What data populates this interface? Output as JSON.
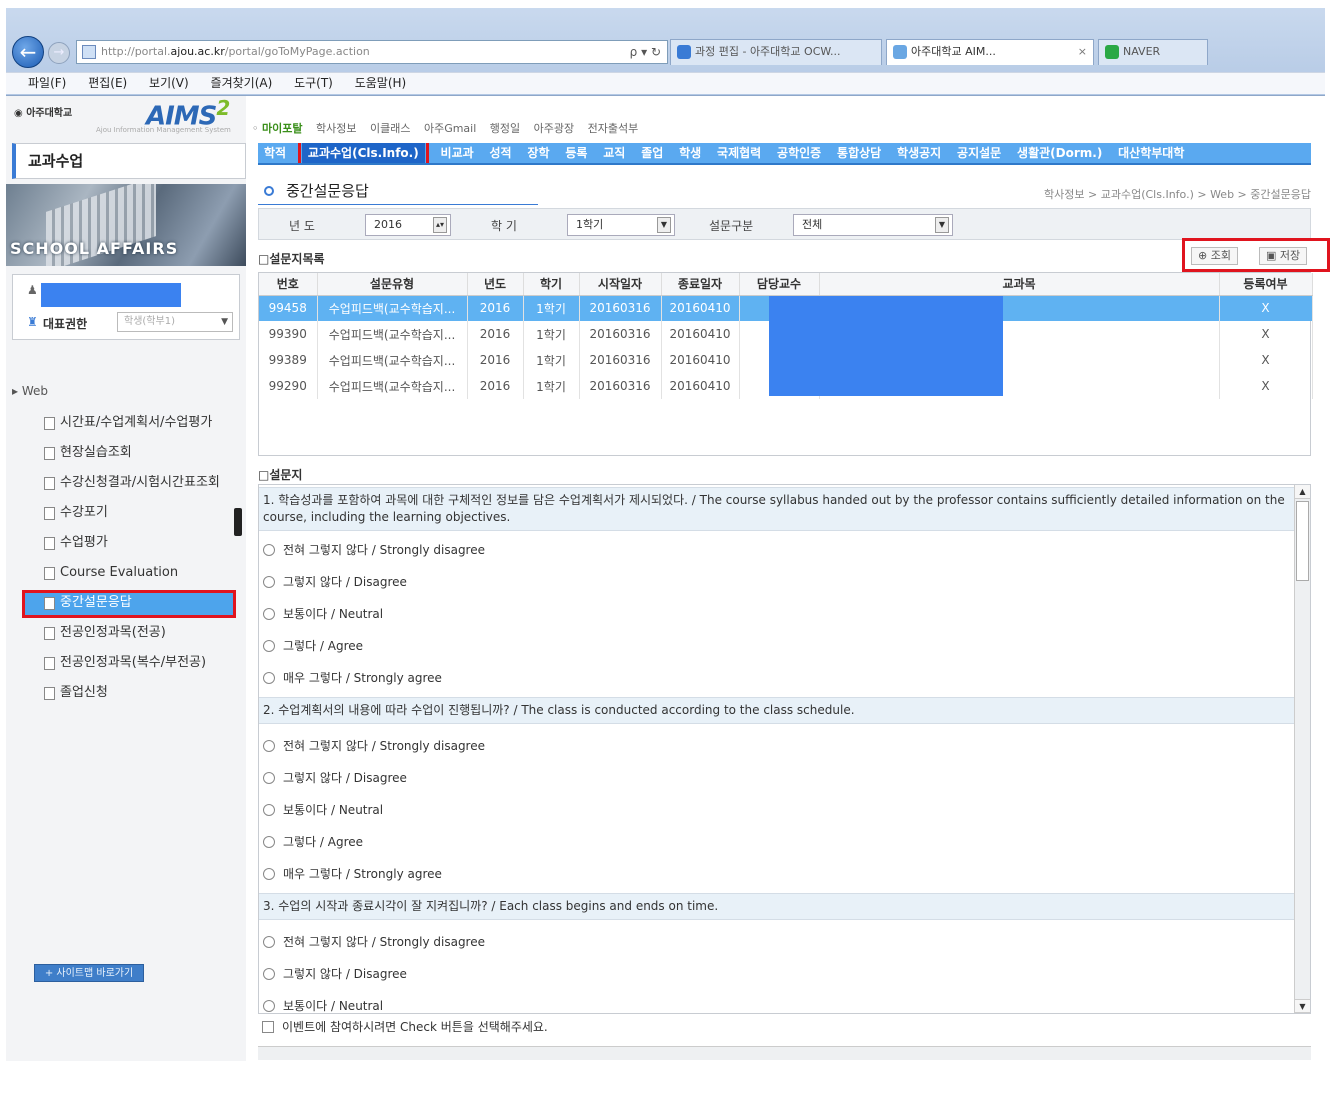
{
  "browser": {
    "url_prefix": "http://portal.",
    "url_domain": "ajou.ac.kr",
    "url_suffix": "/portal/goToMyPage.action",
    "address_controls": "ρ ▾ ↻",
    "tabs": [
      {
        "label": "과정 편집 - 아주대학교 OCW..."
      },
      {
        "label": "아주대학교 AIM...",
        "close": "×"
      },
      {
        "label": "NAVER"
      }
    ],
    "menu": [
      "파일(F)",
      "편집(E)",
      "보기(V)",
      "즐겨찾기(A)",
      "도구(T)",
      "도움말(H)"
    ]
  },
  "sidebar": {
    "univ_logo": "◉ 아주대학교",
    "app_logo": "AIMS",
    "app_logo_sup": "2",
    "app_tagline": "Ajou Information Management System",
    "section_title": "교과수업",
    "banner_text": "SCHOOL AFFAIRS",
    "role_label": "대표권한",
    "role_select": "학생(학부1)",
    "tree_root": "Web",
    "tree_items": [
      {
        "label": "시간표/수업계획서/수업평가"
      },
      {
        "label": "현장실습조회"
      },
      {
        "label": "수강신청결과/시험시간표조회"
      },
      {
        "label": "수강포기"
      },
      {
        "label": "수업평가"
      },
      {
        "label": "Course Evaluation"
      },
      {
        "label": "중간설문응답"
      },
      {
        "label": "전공인정과목(전공)"
      },
      {
        "label": "전공인정과목(복수/부전공)"
      },
      {
        "label": "졸업신청"
      }
    ],
    "sitemap_button": "+ 사이트맵 바로가기"
  },
  "main": {
    "top_links": [
      "마이포탈",
      "학사정보",
      "이클래스",
      "아주Gmail",
      "행정일",
      "아주광장",
      "전자출석부"
    ],
    "gnb": [
      "학적",
      "교과수업(Cls.Info.)",
      "비교과",
      "성적",
      "장학",
      "등록",
      "교직",
      "졸업",
      "학생",
      "국제협력",
      "공학인증",
      "통합상담",
      "학생공지",
      "공지설문",
      "생활관(Dorm.)",
      "대산학부대학"
    ],
    "gnb_active_index": 1,
    "page_title": "중간설문응답",
    "breadcrumb": "학사정보 > 교과수업(Cls.Info.) > Web > 중간설문응답",
    "filter": {
      "year_label": "년 도",
      "year_value": "2016",
      "term_label": "학 기",
      "term_value": "1학기",
      "type_label": "설문구분",
      "type_value": "전체"
    },
    "list_title": "□설문지목록",
    "toolbar": {
      "search": "조회",
      "save": "저장"
    },
    "table": {
      "columns": [
        "번호",
        "설문유형",
        "년도",
        "학기",
        "시작일자",
        "종료일자",
        "담당교수",
        "교과목",
        "등록여부"
      ],
      "rows": [
        [
          "99458",
          "수업피드백(교수학습지...",
          "2016",
          "1학기",
          "20160316",
          "20160410",
          "",
          "",
          "X"
        ],
        [
          "99390",
          "수업피드백(교수학습지...",
          "2016",
          "1학기",
          "20160316",
          "20160410",
          "",
          "",
          "X"
        ],
        [
          "99389",
          "수업피드백(교수학습지...",
          "2016",
          "1학기",
          "20160316",
          "20160410",
          "",
          "",
          "X"
        ],
        [
          "99290",
          "수업피드백(교수학습지...",
          "2016",
          "1학기",
          "20160316",
          "20160410",
          "",
          "",
          "X"
        ]
      ]
    },
    "questions_title": "□설문지",
    "questions": [
      {
        "text": "1. 학습성과를 포함하여 과목에 대한 구체적인 정보를 담은 수업계획서가 제시되었다. / The course syllabus handed out by the professor contains sufficiently detailed information on the course, including the learning objectives.",
        "options": [
          "전혀 그렇지 않다 / Strongly disagree",
          "그렇지 않다 / Disagree",
          "보통이다 / Neutral",
          "그렇다  /  Agree",
          "매우 그렇다  / Strongly agree"
        ]
      },
      {
        "text": "2. 수업계획서의 내용에 따라 수업이 진행됩니까? / The class is conducted according to the class schedule.",
        "options": [
          "전혀 그렇지 않다 / Strongly disagree",
          "그렇지 않다 / Disagree",
          "보통이다 / Neutral",
          "그렇다 / Agree",
          "매우 그렇다 / Strongly agree"
        ]
      },
      {
        "text": "3. 수업의 시작과 종료시각이 잘 지켜집니까? / Each class begins and ends on time.",
        "options": [
          "전혀 그렇지 않다 / Strongly disagree",
          "그렇지 않다 / Disagree",
          "보통이다 / Neutral"
        ]
      }
    ],
    "event_checkbox": "이벤트에 참여하시려면 Check 버튼을 선택해주세요."
  }
}
